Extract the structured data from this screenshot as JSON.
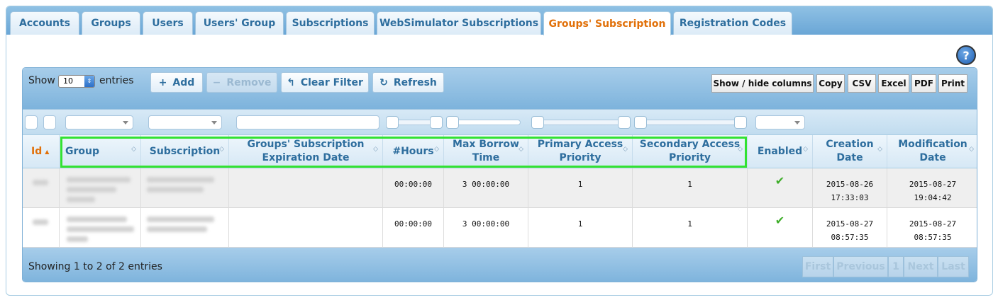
{
  "tabs": [
    "Accounts",
    "Groups",
    "Users",
    "Users' Group",
    "Subscriptions",
    "WebSimulator Subscriptions",
    "Groups' Subscription",
    "Registration Codes"
  ],
  "active_tab": "Groups' Subscription",
  "help_icon": "?",
  "length_menu": {
    "show_label": "Show",
    "value": "10",
    "entries_label": "entries"
  },
  "buttons": {
    "add": {
      "icon": "+",
      "label": "Add"
    },
    "remove": {
      "icon": "−",
      "label": "Remove"
    },
    "clear_filter": {
      "icon": "↰",
      "label": "Clear Filter"
    },
    "refresh": {
      "icon": "↻",
      "label": "Refresh"
    }
  },
  "export_buttons": {
    "show_hide": "Show / hide columns",
    "copy": "Copy",
    "csv": "CSV",
    "excel": "Excel",
    "pdf": "PDF",
    "print": "Print"
  },
  "columns": [
    {
      "label": "Id"
    },
    {
      "label": "Group"
    },
    {
      "label": "Subscription"
    },
    {
      "label": "Groups' Subscription\nExpiration Date"
    },
    {
      "label": "#Hours"
    },
    {
      "label": "Max Borrow\nTime"
    },
    {
      "label": "Primary Access\nPriority"
    },
    {
      "label": "Secondary Access\nPriority"
    },
    {
      "label": "Enabled"
    },
    {
      "label": "Creation\nDate"
    },
    {
      "label": "Modification\nDate"
    }
  ],
  "sort_indicator": "▲",
  "rows": [
    {
      "hours": "00:00:00",
      "max_borrow": "3 00:00:00",
      "primary": "1",
      "secondary": "1",
      "enabled": "✔",
      "creation": "2015-08-26\n17:33:03",
      "modification": "2015-08-27\n19:04:42"
    },
    {
      "hours": "00:00:00",
      "max_borrow": "3 00:00:00",
      "primary": "1",
      "secondary": "1",
      "enabled": "✔",
      "creation": "2015-08-27\n08:57:35",
      "modification": "2015-08-27\n08:57:35"
    }
  ],
  "footer": {
    "info": "Showing 1 to 2 of 2 entries",
    "pagination": {
      "first": "First",
      "previous": "Previous",
      "page": "1",
      "next": "Next",
      "last": "Last"
    }
  },
  "colors": {
    "accent": "#e17009",
    "header_text": "#2e6e9e",
    "highlight": "#32e232",
    "check": "#3fae2a"
  }
}
